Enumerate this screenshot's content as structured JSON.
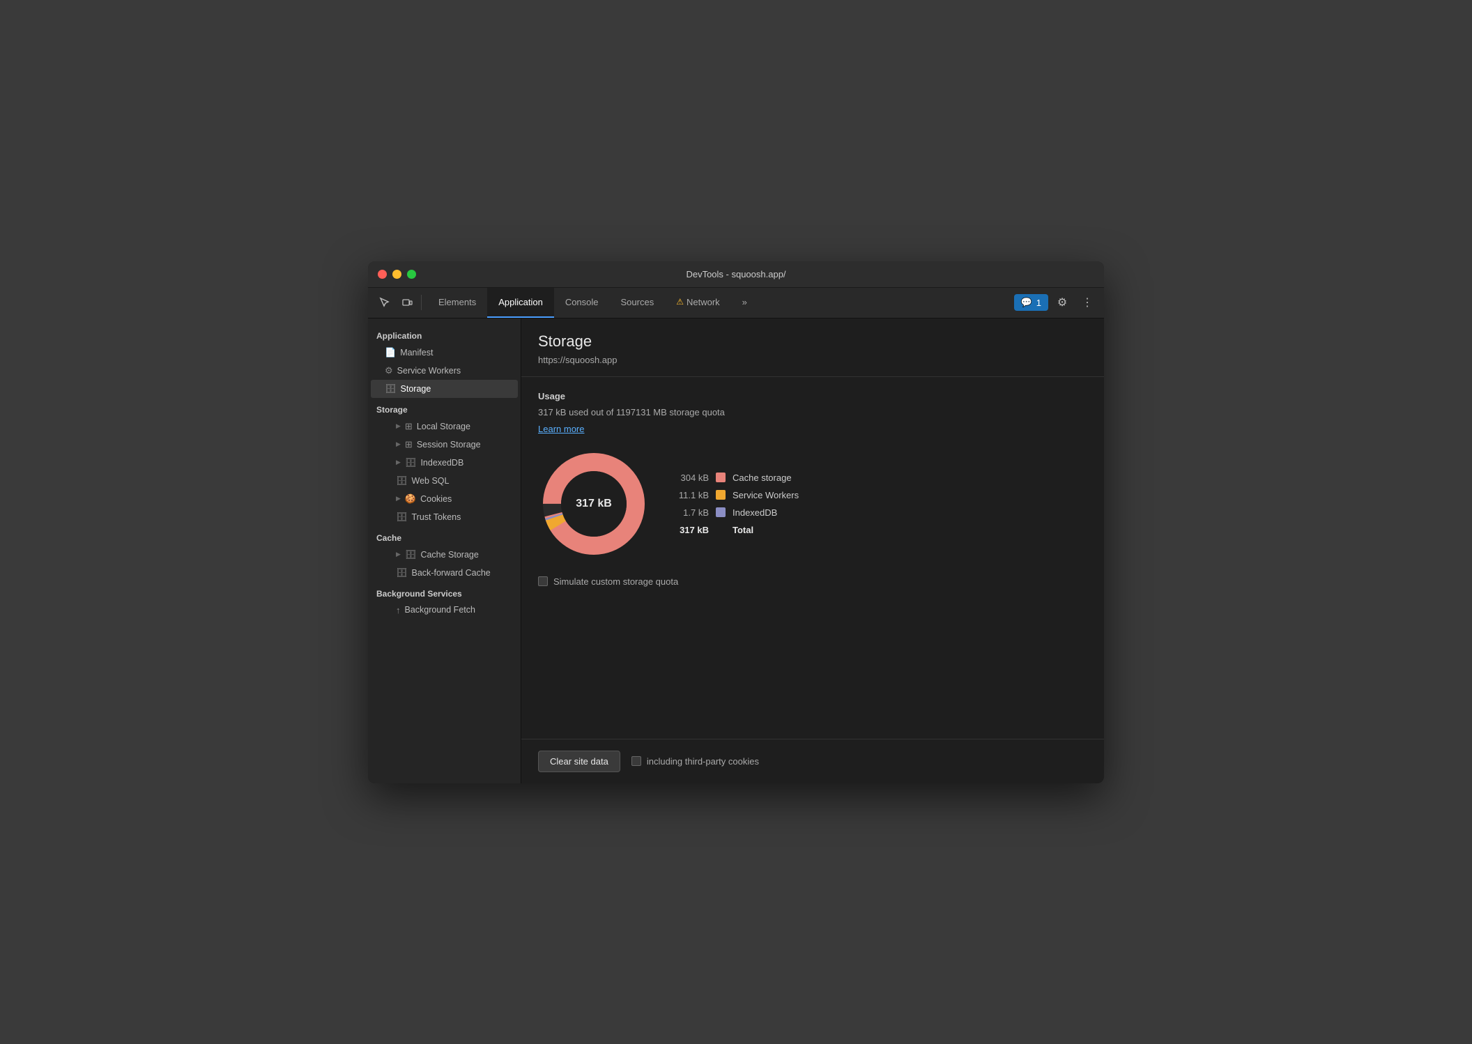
{
  "window": {
    "title": "DevTools - squoosh.app/"
  },
  "toolbar": {
    "tabs": [
      {
        "label": "Elements",
        "active": false,
        "warning": false
      },
      {
        "label": "Application",
        "active": true,
        "warning": false
      },
      {
        "label": "Console",
        "active": false,
        "warning": false
      },
      {
        "label": "Sources",
        "active": false,
        "warning": false
      },
      {
        "label": "Network",
        "active": false,
        "warning": true
      }
    ],
    "more_label": "»",
    "notification_count": "1"
  },
  "sidebar": {
    "section_application": "Application",
    "manifest_label": "Manifest",
    "service_workers_label": "Service Workers",
    "storage_label": "Storage",
    "section_storage": "Storage",
    "local_storage_label": "Local Storage",
    "session_storage_label": "Session Storage",
    "indexeddb_label": "IndexedDB",
    "websql_label": "Web SQL",
    "cookies_label": "Cookies",
    "trust_tokens_label": "Trust Tokens",
    "section_cache": "Cache",
    "cache_storage_label": "Cache Storage",
    "backforward_cache_label": "Back-forward Cache",
    "section_background": "Background Services",
    "background_fetch_label": "Background Fetch"
  },
  "content": {
    "title": "Storage",
    "url": "https://squoosh.app",
    "usage_title": "Usage",
    "usage_text": "317 kB used out of 1197131 MB storage quota",
    "learn_more": "Learn more",
    "donut_center": "317 kB",
    "legend": [
      {
        "value": "304 kB",
        "label": "Cache storage",
        "color": "#e8837a"
      },
      {
        "value": "11.1 kB",
        "label": "Service Workers",
        "color": "#f0a830"
      },
      {
        "value": "1.7 kB",
        "label": "IndexedDB",
        "color": "#8b8ec4"
      }
    ],
    "total_value": "317 kB",
    "total_label": "Total",
    "simulate_label": "Simulate custom storage quota",
    "clear_btn": "Clear site data",
    "third_party_label": "including third-party cookies"
  },
  "donut": {
    "cache_pct": 0.959,
    "workers_pct": 0.035,
    "indexed_pct": 0.006,
    "colors": {
      "cache": "#e8837a",
      "workers": "#f0a830",
      "indexed": "#8b8ec4",
      "bg": "#2a2a2a"
    }
  }
}
